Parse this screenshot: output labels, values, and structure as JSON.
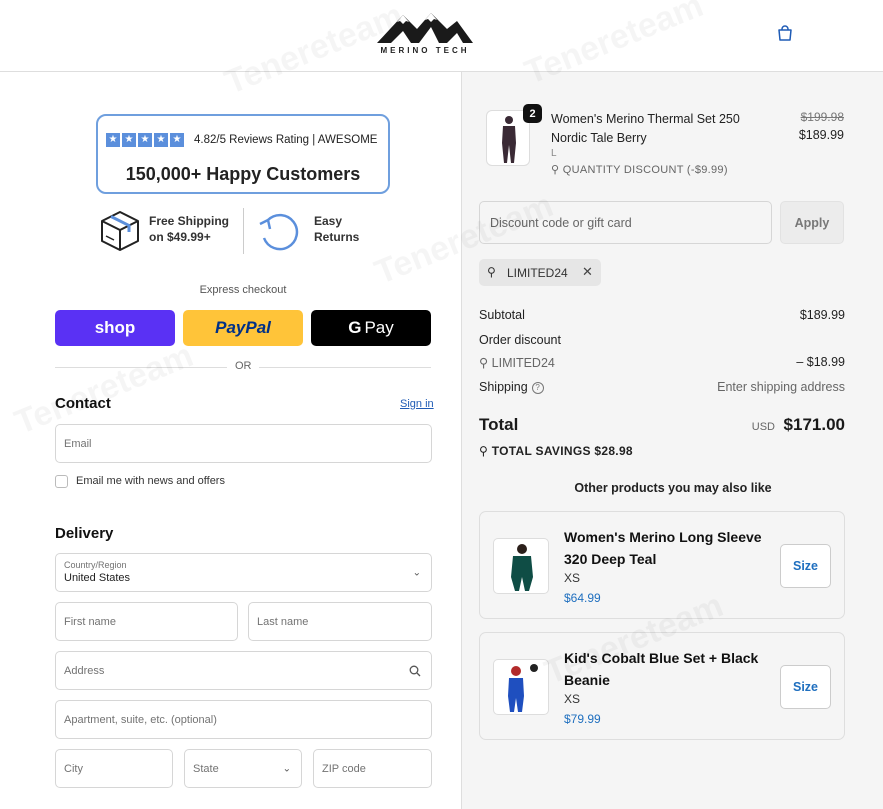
{
  "brand": {
    "name": "MERINO TECH"
  },
  "promo": {
    "rating": "4.82/5 Reviews Rating | AWESOME",
    "customers": "150,000+ Happy Customers",
    "shipping_line1": "Free Shipping",
    "shipping_line2": "on $49.99+",
    "returns_line1": "Easy",
    "returns_line2": "Returns"
  },
  "express": {
    "label": "Express checkout",
    "shop": "shop",
    "paypal": "PayPal",
    "gpay_g": "G",
    "gpay": "Pay",
    "or": "OR"
  },
  "contact": {
    "title": "Contact",
    "signin": "Sign in",
    "email_placeholder": "Email",
    "newsletter": "Email me with news and offers"
  },
  "delivery": {
    "title": "Delivery",
    "country_label": "Country/Region",
    "country_value": "United States",
    "first_name": "First name",
    "last_name": "Last name",
    "address": "Address",
    "apartment": "Apartment, suite, etc. (optional)",
    "city": "City",
    "state": "State",
    "zip": "ZIP code"
  },
  "cart": {
    "item": {
      "qty": "2",
      "name": "Women's Merino Thermal Set 250 Nordic Tale Berry",
      "variant": "L",
      "discount": "QUANTITY DISCOUNT (-$9.99)",
      "price_original": "$199.98",
      "price": "$189.99"
    },
    "discount_placeholder": "Discount code or gift card",
    "apply": "Apply",
    "code": "LIMITED24"
  },
  "summary": {
    "subtotal_label": "Subtotal",
    "subtotal_value": "$189.99",
    "order_discount_label": "Order discount",
    "discount_code": "LIMITED24",
    "discount_value": "– $18.99",
    "shipping_label": "Shipping",
    "shipping_value": "Enter shipping address",
    "total_label": "Total",
    "currency": "USD",
    "total_value": "$171.00",
    "savings": "TOTAL SAVINGS  $28.98"
  },
  "upsell": {
    "title": "Other products you may also like",
    "products": [
      {
        "name": "Women's Merino Long Sleeve 320 Deep Teal",
        "size": "XS",
        "price": "$64.99",
        "button": "Size"
      },
      {
        "name": "Kid's Cobalt Blue Set + Black Beanie",
        "size": "XS",
        "price": "$79.99",
        "button": "Size"
      }
    ]
  },
  "watermark": "Tenereteam",
  "colors": {
    "accent": "#1f6fbf",
    "shop": "#5a31f4",
    "paypal": "#ffc439",
    "rating_border": "#6f9fde"
  }
}
